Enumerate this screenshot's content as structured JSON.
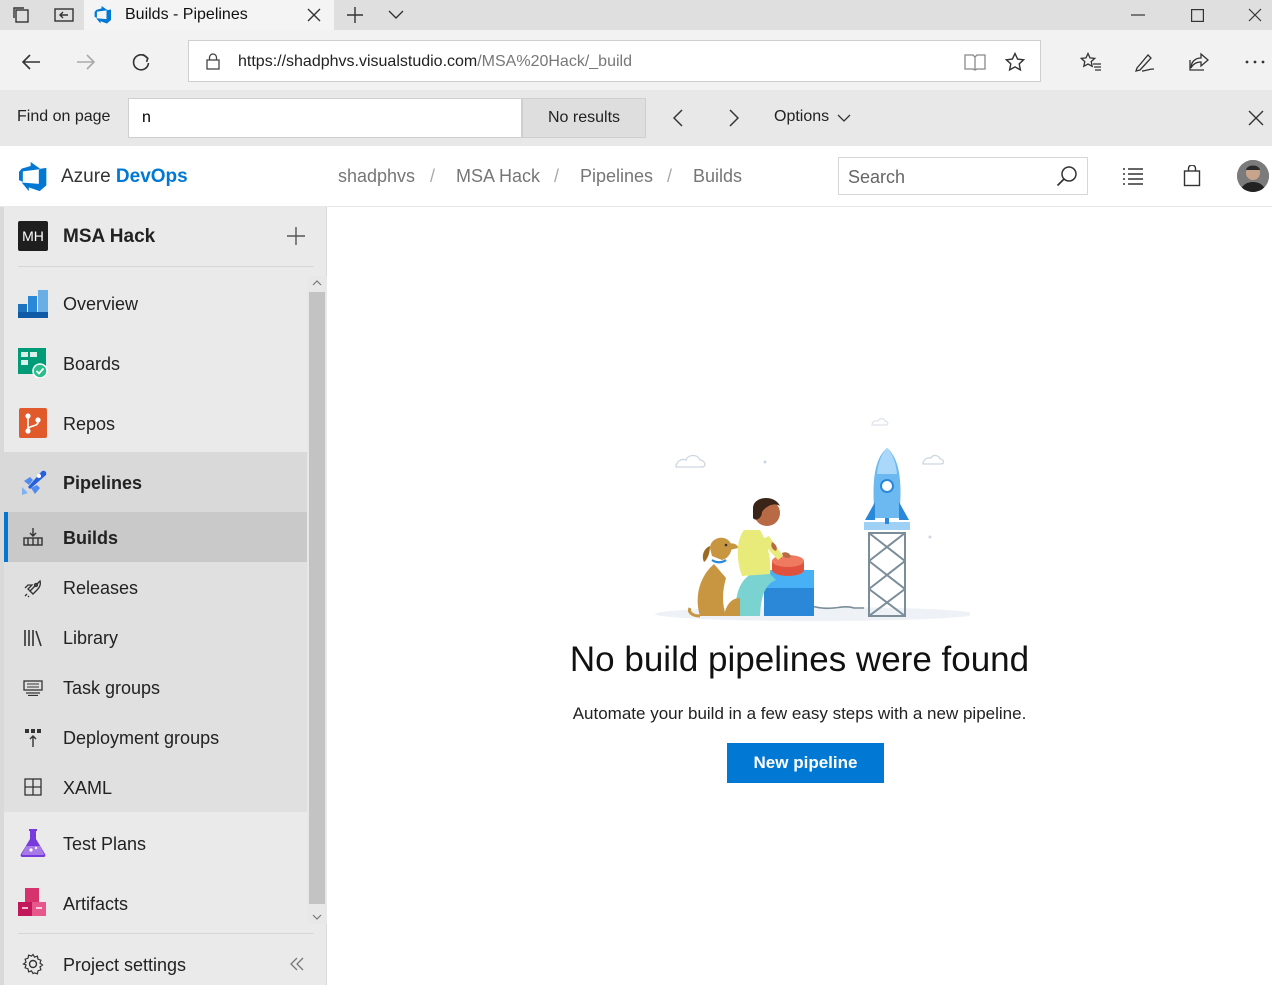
{
  "browser": {
    "tab_title": "Builds - Pipelines",
    "url_host": "https://shadphvs.visualstudio.com",
    "url_path": "/MSA%20Hack/_build"
  },
  "find_bar": {
    "label": "Find on page",
    "query": "n",
    "results": "No results",
    "options_label": "Options"
  },
  "header": {
    "brand_prefix": "Azure",
    "brand_name": "DevOps",
    "breadcrumbs": [
      "shadphvs",
      "MSA Hack",
      "Pipelines",
      "Builds"
    ],
    "breadcrumb_separator": "/",
    "search_placeholder": "Search"
  },
  "sidebar": {
    "project_initials": "MH",
    "project_name": "MSA Hack",
    "items": [
      {
        "label": "Overview",
        "icon": "overview-icon"
      },
      {
        "label": "Boards",
        "icon": "boards-icon"
      },
      {
        "label": "Repos",
        "icon": "repos-icon"
      },
      {
        "label": "Pipelines",
        "icon": "pipelines-icon"
      },
      {
        "label": "Builds",
        "icon": "builds-icon"
      },
      {
        "label": "Releases",
        "icon": "rocket-icon"
      },
      {
        "label": "Library",
        "icon": "library-icon"
      },
      {
        "label": "Task groups",
        "icon": "task-groups-icon"
      },
      {
        "label": "Deployment groups",
        "icon": "deployment-groups-icon"
      },
      {
        "label": "XAML",
        "icon": "xaml-grid-icon"
      },
      {
        "label": "Test Plans",
        "icon": "test-plans-icon"
      },
      {
        "label": "Artifacts",
        "icon": "artifacts-icon"
      }
    ],
    "settings_label": "Project settings"
  },
  "main": {
    "empty_title": "No build pipelines were found",
    "empty_description": "Automate your build in a few easy steps with a new pipeline.",
    "new_pipeline_label": "New pipeline"
  },
  "colors": {
    "accent": "#0078d4",
    "selected_row": "#c9c9c9"
  }
}
